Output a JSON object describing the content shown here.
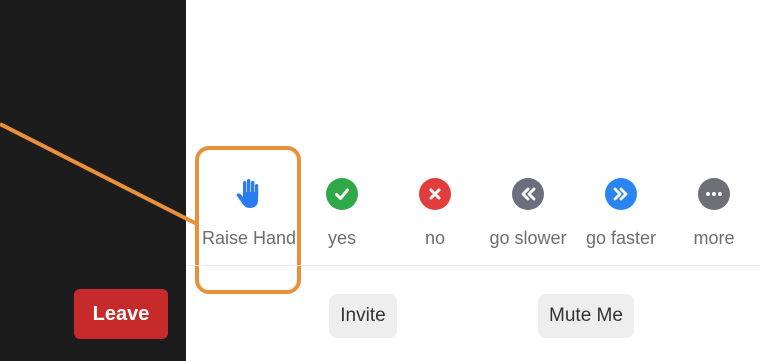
{
  "colors": {
    "dark_panel": "#1c1c1c",
    "leave": "#c62a2a",
    "highlight": "#e8913a",
    "yes": "#2fa84a",
    "no": "#e23d3d",
    "go_slower": "#6b6e7c",
    "go_faster": "#2a85f0",
    "more": "#6e6e76",
    "raise_hand": "#2a7cf0"
  },
  "sidebar": {
    "leave_label": "Leave"
  },
  "reactions": [
    {
      "icon": "raised-hand-icon",
      "label": "Raise Hand"
    },
    {
      "icon": "checkmark-icon",
      "label": "yes"
    },
    {
      "icon": "x-icon",
      "label": "no"
    },
    {
      "icon": "rewind-icon",
      "label": "go slower"
    },
    {
      "icon": "fast-forward-icon",
      "label": "go faster"
    },
    {
      "icon": "ellipsis-icon",
      "label": "more"
    }
  ],
  "actions": {
    "invite_label": "Invite",
    "mute_label": "Mute Me"
  }
}
